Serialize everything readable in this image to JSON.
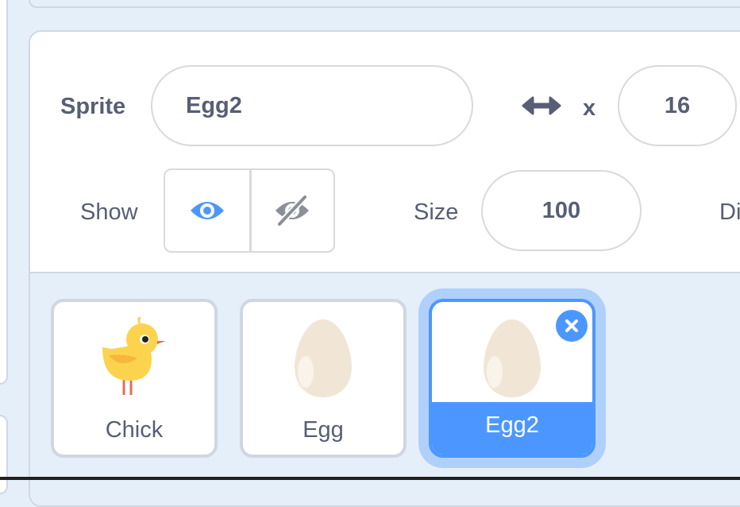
{
  "sprite_info": {
    "sprite_label": "Sprite",
    "sprite_name": "Egg2",
    "x_label": "x",
    "x_value": "16",
    "show_label": "Show",
    "size_label": "Size",
    "size_value": "100",
    "direction_label_partial": "Di"
  },
  "sprites": [
    {
      "name": "Chick",
      "icon": "chick-costume",
      "selected": false
    },
    {
      "name": "Egg",
      "icon": "egg-costume",
      "selected": false
    },
    {
      "name": "Egg2",
      "icon": "egg-costume",
      "selected": true
    }
  ],
  "colors": {
    "accent": "#4c97ff",
    "text": "#575e75",
    "panel_bg": "#e5effa",
    "border": "#d9d9d9"
  }
}
